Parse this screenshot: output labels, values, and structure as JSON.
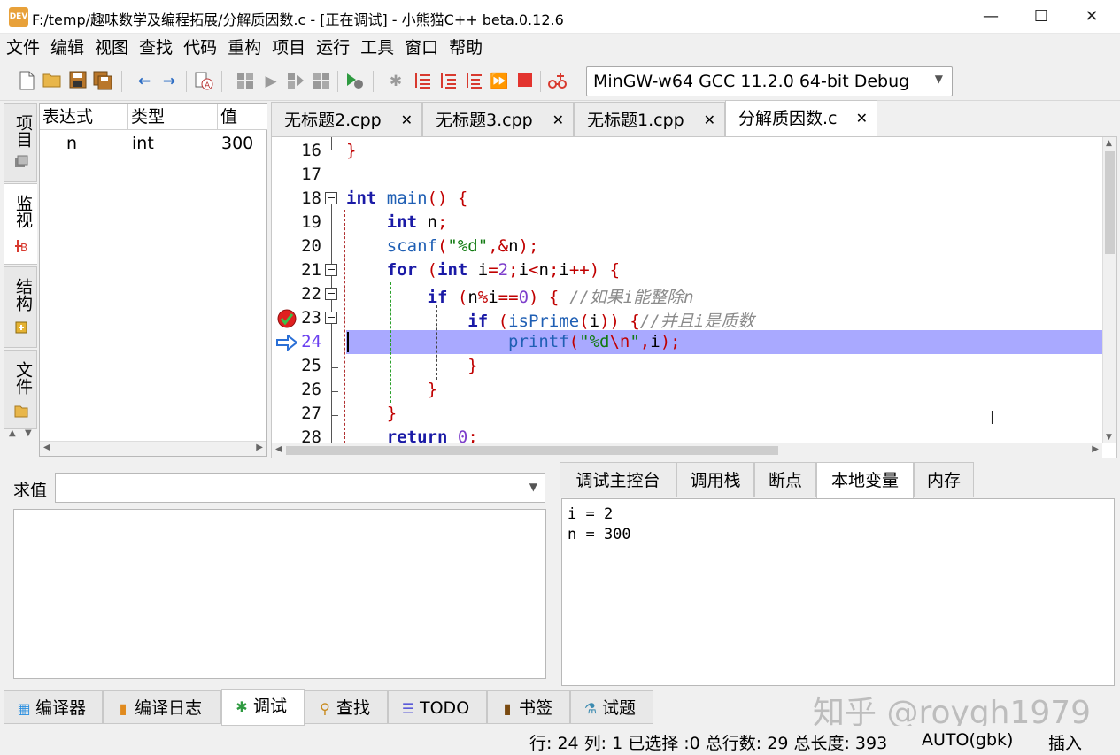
{
  "window": {
    "app_icon_text": "DEV",
    "title": "F:/temp/趣味数学及编程拓展/分解质因数.c - [正在调试] - 小熊猫C++ beta.0.12.6",
    "minimize": "—",
    "maximize": "☐",
    "close": "✕"
  },
  "menu": [
    "文件",
    "编辑",
    "视图",
    "查找",
    "代码",
    "重构",
    "项目",
    "运行",
    "工具",
    "窗口",
    "帮助"
  ],
  "toolbar": {
    "compiler": "MinGW-w64 GCC 11.2.0 64-bit Debug"
  },
  "left_tabs": [
    "项目",
    "监视",
    "结构",
    "文件"
  ],
  "watch": {
    "headers": [
      "表达式",
      "类型",
      "值"
    ],
    "rows": [
      {
        "expr": "n",
        "type": "int",
        "value": "300"
      }
    ]
  },
  "editor_tabs": [
    "无标题2.cpp",
    "无标题3.cpp",
    "无标题1.cpp",
    "分解质因数.c"
  ],
  "editor": {
    "line_numbers": [
      "16",
      "17",
      "18",
      "19",
      "20",
      "21",
      "22",
      "23",
      "24",
      "25",
      "26",
      "27",
      "28"
    ],
    "comment1": "//如果i能整除n",
    "comment2": "//并且i是质数"
  },
  "eval": {
    "label": "求值",
    "value": ""
  },
  "debug_tabs": [
    "调试主控台",
    "调用栈",
    "断点",
    "本地变量",
    "内存"
  ],
  "locals": [
    "i = 2",
    "n = 300"
  ],
  "bottom_tabs": [
    "编译器",
    "编译日志",
    "调试",
    "查找",
    "TODO",
    "书签",
    "试题"
  ],
  "watermark": "知乎 @roygh1979",
  "status": {
    "position": "行: 24 列: 1 已选择 :0 总行数: 29 总长度: 393",
    "encoding": "AUTO(gbk)",
    "mode": "插入"
  },
  "colors": {
    "current_line": "#a9a9ff",
    "keyword": "#1a1aa6",
    "string": "#117a11",
    "number": "#7d3ecb",
    "bracket": "#c00000",
    "comment": "#8a8a8a"
  }
}
